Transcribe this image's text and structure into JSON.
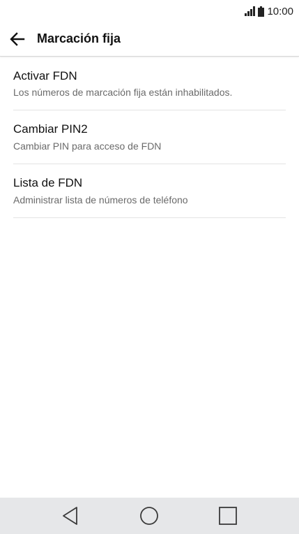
{
  "status_bar": {
    "time": "10:00",
    "icons": [
      "signal-icon",
      "battery-icon"
    ]
  },
  "app_bar": {
    "back_icon": "arrow-left-icon",
    "title": "Marcación fija"
  },
  "settings": {
    "items": [
      {
        "title": "Activar FDN",
        "summary": "Los números de marcación fija están inhabilitados."
      },
      {
        "title": "Cambiar PIN2",
        "summary": "Cambiar PIN para acceso de FDN"
      },
      {
        "title": "Lista de FDN",
        "summary": "Administrar lista de números de teléfono"
      }
    ]
  },
  "nav_bar": {
    "icons": [
      "back-triangle-icon",
      "home-circle-icon",
      "recents-square-icon"
    ]
  },
  "colors": {
    "background": "#ffffff",
    "nav_bar": "#e6e7e9",
    "divider": "#e3e3e3",
    "title_text": "#111111",
    "summary_text": "#6a6a6a"
  }
}
